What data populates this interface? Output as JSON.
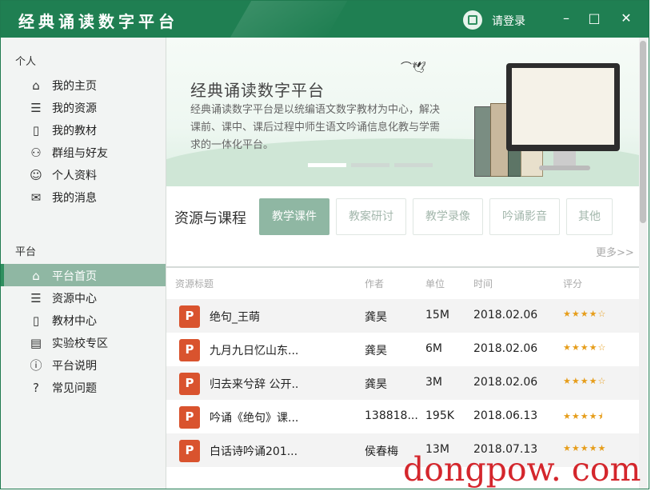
{
  "app": {
    "title": "经典诵读数字平台",
    "login_text": "请登录",
    "minimize": "–",
    "maximize": "□",
    "close": "✕"
  },
  "sidebar": {
    "section_personal": "个人",
    "personal_items": [
      {
        "label": "我的主页",
        "icon": "home-icon",
        "glyph": "⌂"
      },
      {
        "label": "我的资源",
        "icon": "list-icon",
        "glyph": "☰"
      },
      {
        "label": "我的教材",
        "icon": "book-icon",
        "glyph": "▯"
      },
      {
        "label": "群组与好友",
        "icon": "group-icon",
        "glyph": "⚇"
      },
      {
        "label": "个人资料",
        "icon": "user-icon",
        "glyph": "☺"
      },
      {
        "label": "我的消息",
        "icon": "mail-icon",
        "glyph": "✉"
      }
    ],
    "section_platform": "平台",
    "platform_items": [
      {
        "label": "平台首页",
        "icon": "home-icon",
        "glyph": "⌂",
        "active": true
      },
      {
        "label": "资源中心",
        "icon": "list-icon",
        "glyph": "☰"
      },
      {
        "label": "教材中心",
        "icon": "book-icon",
        "glyph": "▯"
      },
      {
        "label": "实验校专区",
        "icon": "document-icon",
        "glyph": "▤"
      },
      {
        "label": "平台说明",
        "icon": "info-icon",
        "glyph": "ⓘ"
      },
      {
        "label": "常见问题",
        "icon": "question-icon",
        "glyph": "?"
      }
    ]
  },
  "banner": {
    "title": "经典诵读数字平台",
    "desc": "经典诵读数字平台是以统编语文数字教材为中心，解决课前、课中、课后过程中师生语文吟诵信息化教与学需求的一体化平台。"
  },
  "resources": {
    "title": "资源与课程",
    "tabs": [
      "教学课件",
      "教案研讨",
      "教学录像",
      "吟诵影音",
      "其他"
    ],
    "active_tab": 0,
    "more": "更多>>",
    "columns": [
      "资源标题",
      "作者",
      "单位",
      "时间",
      "评分"
    ],
    "rows": [
      {
        "title": "绝句_王萌",
        "author": "龚昊",
        "size": "15M",
        "date": "2018.02.06",
        "rating": 4
      },
      {
        "title": "九月九日忆山东...",
        "author": "龚昊",
        "size": "6M",
        "date": "2018.02.06",
        "rating": 4
      },
      {
        "title": "归去来兮辞 公开..",
        "author": "龚昊",
        "size": "3M",
        "date": "2018.02.06",
        "rating": 4
      },
      {
        "title": "吟诵《绝句》课...",
        "author": "138818...",
        "size": "195K",
        "date": "2018.06.13",
        "rating": 4.5
      },
      {
        "title": "白话诗吟诵201...",
        "author": "侯春梅",
        "size": "13M",
        "date": "2018.07.13",
        "rating": 5
      }
    ]
  },
  "watermark": "dongpow. com",
  "colors": {
    "brand": "#1f7f52",
    "active": "#8fb7a3",
    "ppt": "#d9532e",
    "star": "#e69d1a"
  }
}
